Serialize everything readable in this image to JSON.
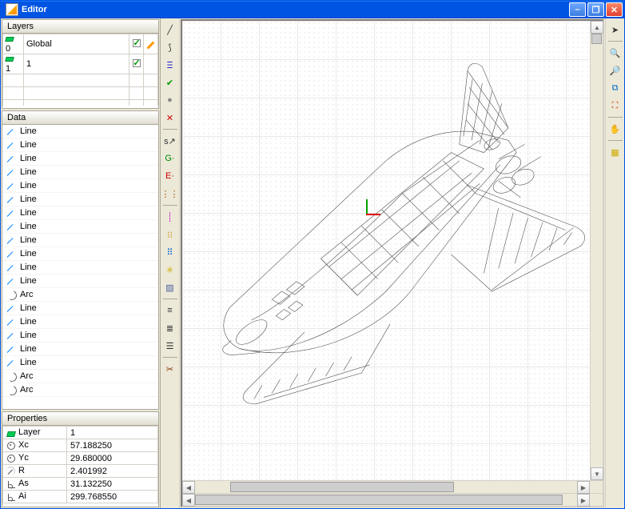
{
  "window": {
    "title": "Editor"
  },
  "panels": {
    "layers": "Layers",
    "data": "Data",
    "properties": "Properties"
  },
  "layers": [
    {
      "index": "0",
      "name": "Global",
      "visible": true,
      "current": true
    },
    {
      "index": "1",
      "name": "1",
      "visible": true,
      "current": false
    }
  ],
  "data_items": [
    {
      "type": "Line",
      "label": "Line"
    },
    {
      "type": "Line",
      "label": "Line"
    },
    {
      "type": "Line",
      "label": "Line"
    },
    {
      "type": "Line",
      "label": "Line"
    },
    {
      "type": "Line",
      "label": "Line"
    },
    {
      "type": "Line",
      "label": "Line"
    },
    {
      "type": "Line",
      "label": "Line"
    },
    {
      "type": "Line",
      "label": "Line"
    },
    {
      "type": "Line",
      "label": "Line"
    },
    {
      "type": "Line",
      "label": "Line"
    },
    {
      "type": "Line",
      "label": "Line"
    },
    {
      "type": "Line",
      "label": "Line"
    },
    {
      "type": "Arc",
      "label": "Arc"
    },
    {
      "type": "Line",
      "label": "Line"
    },
    {
      "type": "Line",
      "label": "Line"
    },
    {
      "type": "Line",
      "label": "Line"
    },
    {
      "type": "Line",
      "label": "Line"
    },
    {
      "type": "Line",
      "label": "Line"
    },
    {
      "type": "Arc",
      "label": "Arc"
    },
    {
      "type": "Arc",
      "label": "Arc"
    }
  ],
  "properties": [
    {
      "name": "Layer",
      "value": "1",
      "icon": "layer"
    },
    {
      "name": "Xc",
      "value": "57.188250",
      "icon": "circ"
    },
    {
      "name": "Yc",
      "value": "29.680000",
      "icon": "circ"
    },
    {
      "name": "R",
      "value": "2.401992",
      "icon": "rad"
    },
    {
      "name": "As",
      "value": "31.132250",
      "icon": "ang"
    },
    {
      "name": "Ai",
      "value": "299.768550",
      "icon": "ang"
    }
  ],
  "left_tools": [
    {
      "id": "tool-line",
      "glyph": "╱"
    },
    {
      "id": "tool-arc",
      "glyph": "⟆"
    },
    {
      "id": "tool-polyline",
      "glyph": "Ⲷ",
      "color": "#0000cc"
    },
    {
      "id": "tool-confirm",
      "glyph": "✔",
      "color": "#009900"
    },
    {
      "id": "tool-circle-fill",
      "glyph": "●",
      "color": "#888"
    },
    {
      "id": "tool-delete",
      "glyph": "✕",
      "color": "#cc0000"
    },
    {
      "sep": true
    },
    {
      "id": "tool-snap",
      "glyph": "s↗"
    },
    {
      "id": "tool-grid-g",
      "glyph": "G·",
      "color": "#008800"
    },
    {
      "id": "tool-grid-e",
      "glyph": "E·",
      "color": "#cc0000"
    },
    {
      "id": "tool-dots",
      "glyph": "⋮⋮",
      "color": "#a05000"
    },
    {
      "sep": true
    },
    {
      "id": "tool-v1",
      "glyph": "┊",
      "color": "#cc00cc"
    },
    {
      "id": "tool-v2",
      "glyph": "⁝⁝",
      "color": "#cc8800"
    },
    {
      "id": "tool-nodes",
      "glyph": "⠿",
      "color": "#0060cc"
    },
    {
      "id": "tool-bulb",
      "glyph": "✳",
      "color": "#ccaa00"
    },
    {
      "id": "tool-hatch",
      "glyph": "▨",
      "color": "#5060a0"
    },
    {
      "sep": true
    },
    {
      "id": "tool-align1",
      "glyph": "≡"
    },
    {
      "id": "tool-align2",
      "glyph": "≣"
    },
    {
      "id": "tool-align3",
      "glyph": "☰"
    },
    {
      "sep": true
    },
    {
      "id": "tool-cut",
      "glyph": "✂",
      "color": "#883300"
    }
  ],
  "right_tools": [
    {
      "id": "tool-pointer",
      "glyph": "➤"
    },
    {
      "sep": true
    },
    {
      "id": "tool-zoom-in",
      "glyph": "🔍"
    },
    {
      "id": "tool-zoom-out",
      "glyph": "🔎"
    },
    {
      "id": "tool-zoom-window",
      "glyph": "⧉",
      "color": "#0066cc"
    },
    {
      "id": "tool-zoom-fit",
      "glyph": "⛶",
      "color": "#cc4400"
    },
    {
      "sep": true
    },
    {
      "id": "tool-pan",
      "glyph": "✋"
    },
    {
      "sep": true
    },
    {
      "id": "tool-5",
      "glyph": "▦",
      "color": "#ccaa00"
    }
  ]
}
